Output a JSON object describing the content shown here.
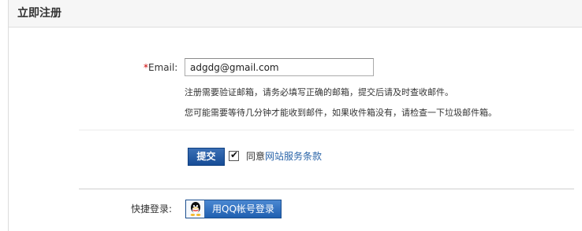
{
  "header": {
    "title": "立即注册"
  },
  "form": {
    "email": {
      "required_mark": "*",
      "label": "Email:",
      "value": "adgdg@gmail.com"
    },
    "hints": [
      "注册需要验证邮箱，请务必填写正确的邮箱，提交后请及时查收邮件。",
      "您可能需要等待几分钟才能收到邮件，如果收件箱没有，请检查一下垃圾邮件箱。"
    ],
    "submit_label": "提交",
    "agree": {
      "checked": true,
      "prefix": "同意",
      "link_text": "网站服务条款"
    }
  },
  "quick_login": {
    "label": "快捷登录:",
    "qq_button_label": "用QQ帐号登录"
  },
  "colors": {
    "accent_blue": "#174d97",
    "link_blue": "#2a64a8",
    "required_red": "#cc0000"
  }
}
